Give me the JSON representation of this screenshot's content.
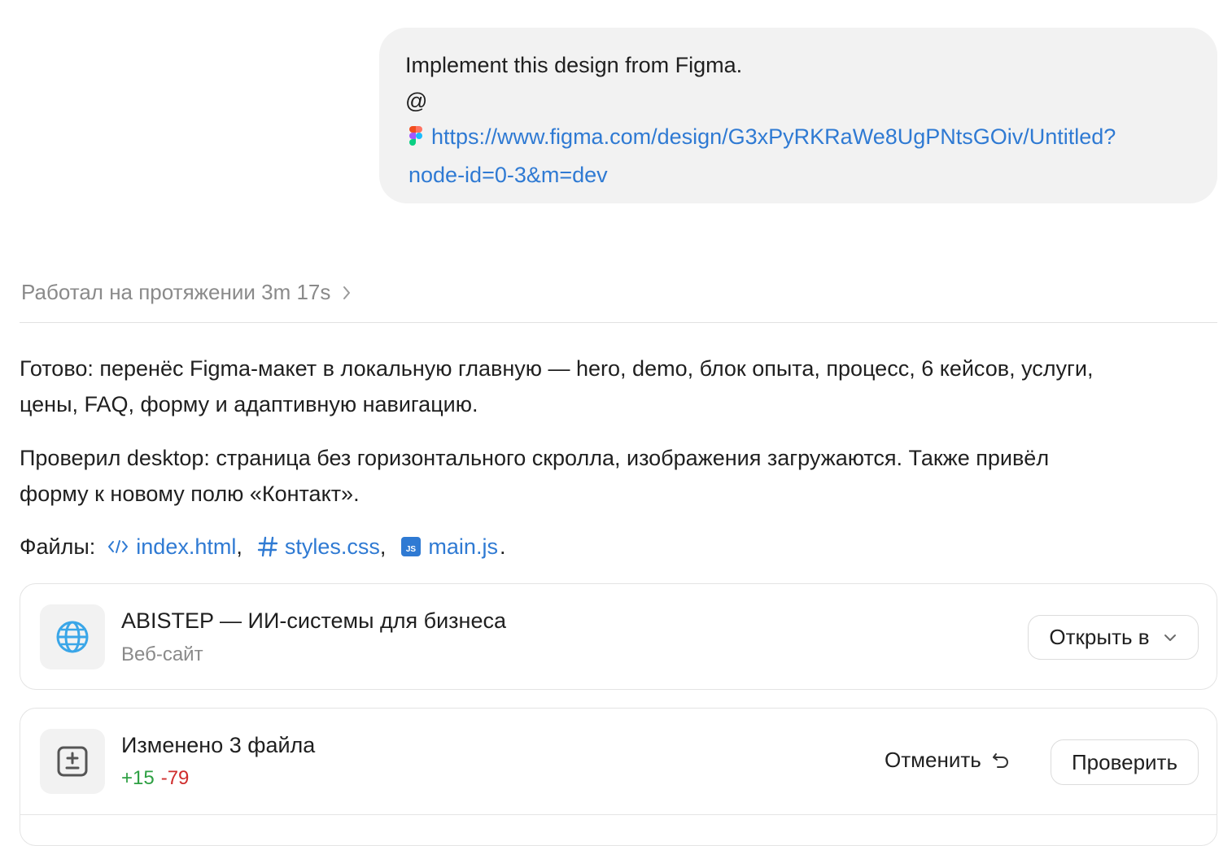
{
  "user_message": {
    "line1": "Implement this design from Figma.",
    "line2": "@",
    "link_part1": "https://www.figma.com/design/G3xPyRKRaWe8UgPNtsGOiv/Untitled?",
    "link_part2": "node-id=0-3&m=dev"
  },
  "worked": {
    "label": "Работал на протяжении 3m 17s"
  },
  "response": {
    "para1_line1": "Готово: перенёс Figma-макет в локальную главную — hero, demo, блок опыта, процесс, 6 кейсов, услуги,",
    "para1_line2": "цены, FAQ, форму и адаптивную навигацию.",
    "para2_line1": "Проверил desktop: страница без горизонтального скролла, изображения загружаются. Также привёл",
    "para2_line2": "форму к новому полю «Контакт».",
    "files_label": "Файлы:",
    "files": [
      {
        "name": "index.html",
        "icon": "code-icon",
        "sep": ","
      },
      {
        "name": "styles.css",
        "icon": "hash-icon",
        "sep": ","
      },
      {
        "name": "main.js",
        "icon": "js-file-icon",
        "sep": "."
      }
    ]
  },
  "site_card": {
    "title": "ABISTEP — ИИ-системы для бизнеса",
    "subtitle": "Веб-сайт",
    "icon": "globe-icon",
    "open_button": "Открыть в",
    "accent": "#3aa6e8"
  },
  "changes_card": {
    "title": "Изменено 3 файла",
    "additions": "+15",
    "deletions": "-79",
    "icon": "diff-icon",
    "undo_button": "Отменить",
    "review_button": "Проверить",
    "add_color": "#2ea043",
    "del_color": "#cf2d2d"
  }
}
